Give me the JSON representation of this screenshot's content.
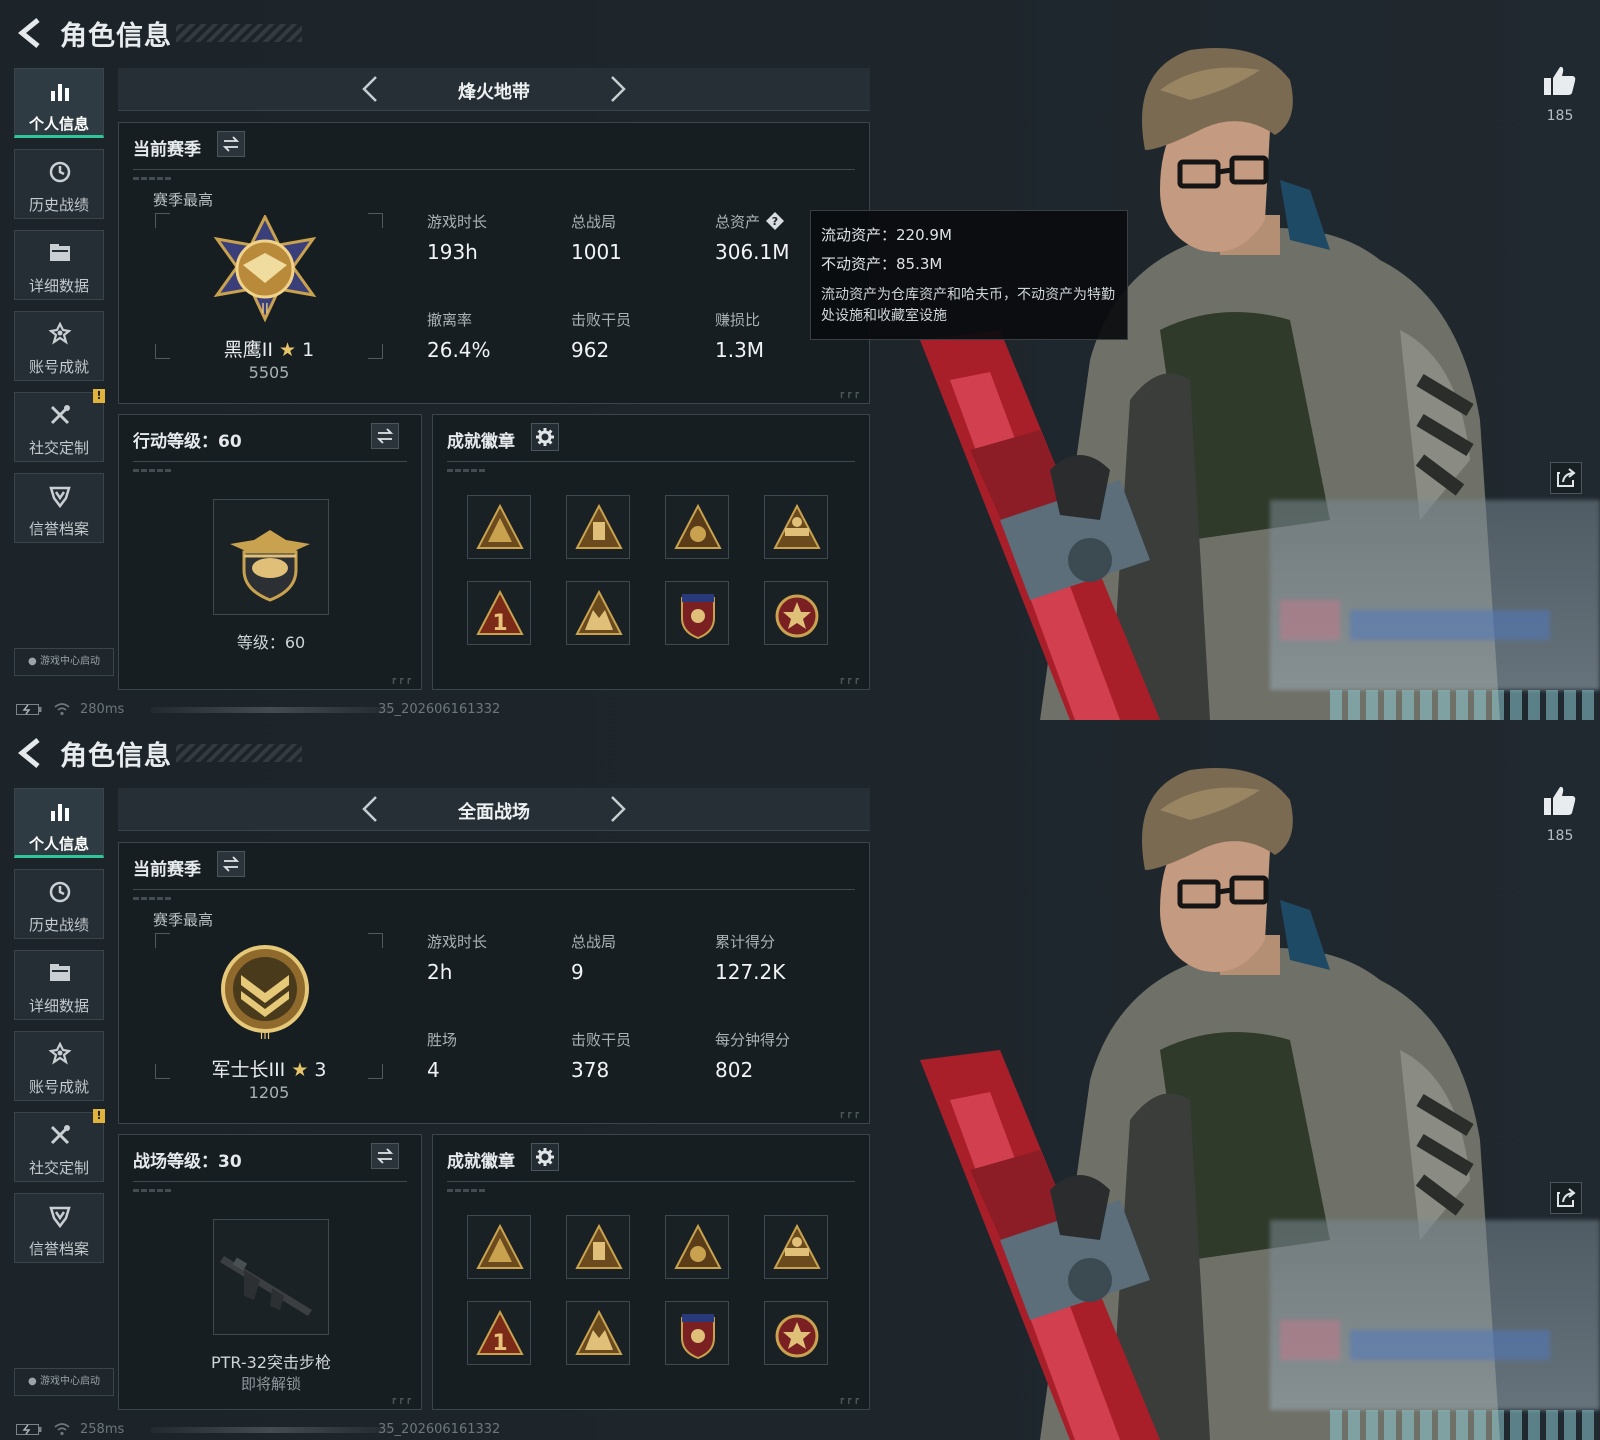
{
  "panels": [
    {
      "header": {
        "title": "角色信息"
      },
      "nav": [
        {
          "label": "个人信息",
          "icon": "bar-chart-icon",
          "active": true
        },
        {
          "label": "历史战绩",
          "icon": "history-clock-icon"
        },
        {
          "label": "详细数据",
          "icon": "folder-icon"
        },
        {
          "label": "账号成就",
          "icon": "achievement-icon"
        },
        {
          "label": "社交定制",
          "icon": "tools-icon",
          "badge": "!"
        },
        {
          "label": "信誉档案",
          "icon": "credit-shield-icon"
        }
      ],
      "launch_label": "游戏中心启动",
      "status": {
        "ping": "280ms",
        "build": "35_202606161332"
      },
      "mode": {
        "name": "烽火地带"
      },
      "season": {
        "title": "当前赛季",
        "best_label": "赛季最高",
        "rank_name": "黑鹰II",
        "rank_stars": "1",
        "rank_points": "5505",
        "stats": [
          {
            "label": "游戏时长",
            "value": "193h"
          },
          {
            "label": "总战局",
            "value": "1001"
          },
          {
            "label": "总资产",
            "value": "306.1M",
            "help": true
          },
          {
            "label": "撤离率",
            "value": "26.4%"
          },
          {
            "label": "击败干员",
            "value": "962"
          },
          {
            "label": "赚损比",
            "value": "1.3M"
          }
        ]
      },
      "tooltip": {
        "line1": "流动资产：220.9M",
        "line2": "不动资产：85.3M",
        "note": "流动资产为仓库资产和哈夫币，不动资产为特勤处设施和收藏室设施"
      },
      "level": {
        "title": "行动等级：60",
        "caption": "等级：60",
        "sub": ""
      },
      "badges_title": "成就徽章",
      "likes": "185"
    },
    {
      "header": {
        "title": "角色信息"
      },
      "nav": [
        {
          "label": "个人信息",
          "icon": "bar-chart-icon",
          "active": true
        },
        {
          "label": "历史战绩",
          "icon": "history-clock-icon"
        },
        {
          "label": "详细数据",
          "icon": "folder-icon"
        },
        {
          "label": "账号成就",
          "icon": "achievement-icon"
        },
        {
          "label": "社交定制",
          "icon": "tools-icon",
          "badge": "!"
        },
        {
          "label": "信誉档案",
          "icon": "credit-shield-icon"
        }
      ],
      "launch_label": "游戏中心启动",
      "status": {
        "ping": "258ms",
        "build": "35_202606161332"
      },
      "mode": {
        "name": "全面战场"
      },
      "season": {
        "title": "当前赛季",
        "best_label": "赛季最高",
        "rank_name": "军士长III",
        "rank_stars": "3",
        "rank_points": "1205",
        "stats": [
          {
            "label": "游戏时长",
            "value": "2h"
          },
          {
            "label": "总战局",
            "value": "9"
          },
          {
            "label": "累计得分",
            "value": "127.2K"
          },
          {
            "label": "胜场",
            "value": "4"
          },
          {
            "label": "击败干员",
            "value": "378"
          },
          {
            "label": "每分钟得分",
            "value": "802"
          }
        ]
      },
      "level": {
        "title": "战场等级：30",
        "caption": "PTR-32突击步枪",
        "sub": "即将解锁"
      },
      "badges_title": "成就徽章",
      "likes": "185"
    }
  ],
  "colors": {
    "accent": "#2fc79a",
    "gold": "#c9a24f",
    "badge_warning": "#e2b33c",
    "weapon_red": "#b3202c"
  }
}
